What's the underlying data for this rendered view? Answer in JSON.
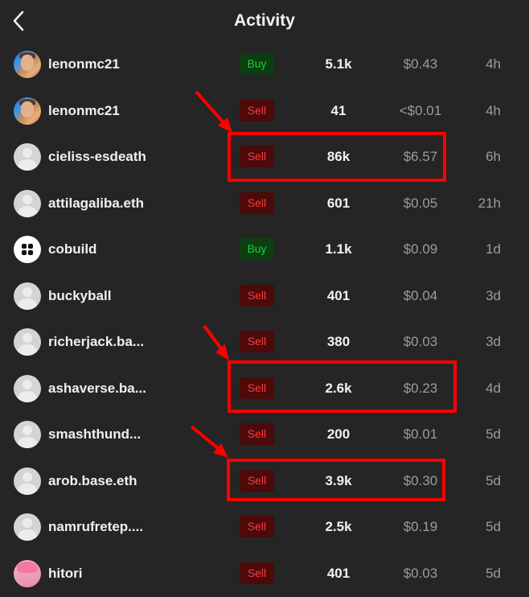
{
  "header": {
    "title": "Activity",
    "back_icon": "chevron-left-icon"
  },
  "colors": {
    "buy": "#19d337",
    "sell": "#ff3b3b",
    "highlight": "#ff0000"
  },
  "rows": [
    {
      "user": "lenonmc21",
      "avatar": "photo",
      "type": "Buy",
      "amount": "5.1k",
      "usd": "$0.43",
      "time": "4h"
    },
    {
      "user": "lenonmc21",
      "avatar": "photo",
      "type": "Sell",
      "amount": "41",
      "usd": "<$0.01",
      "time": "4h"
    },
    {
      "user": "cieliss-esdeath",
      "avatar": "default",
      "type": "Sell",
      "amount": "86k",
      "usd": "$6.57",
      "time": "6h"
    },
    {
      "user": "attilagaliba.eth",
      "avatar": "default",
      "type": "Sell",
      "amount": "601",
      "usd": "$0.05",
      "time": "21h"
    },
    {
      "user": "cobuild",
      "avatar": "logo",
      "type": "Buy",
      "amount": "1.1k",
      "usd": "$0.09",
      "time": "1d"
    },
    {
      "user": "buckyball",
      "avatar": "default",
      "type": "Sell",
      "amount": "401",
      "usd": "$0.04",
      "time": "3d"
    },
    {
      "user": "richerjack.ba...",
      "avatar": "default",
      "type": "Sell",
      "amount": "380",
      "usd": "$0.03",
      "time": "3d"
    },
    {
      "user": "ashaverse.ba...",
      "avatar": "default",
      "type": "Sell",
      "amount": "2.6k",
      "usd": "$0.23",
      "time": "4d"
    },
    {
      "user": "smashthund...",
      "avatar": "default",
      "type": "Sell",
      "amount": "200",
      "usd": "$0.01",
      "time": "5d"
    },
    {
      "user": "arob.base.eth",
      "avatar": "default",
      "type": "Sell",
      "amount": "3.9k",
      "usd": "$0.30",
      "time": "5d"
    },
    {
      "user": "namrufretep....",
      "avatar": "default",
      "type": "Sell",
      "amount": "2.5k",
      "usd": "$0.19",
      "time": "5d"
    },
    {
      "user": "hitori",
      "avatar": "anime",
      "type": "Sell",
      "amount": "401",
      "usd": "$0.03",
      "time": "5d"
    }
  ]
}
